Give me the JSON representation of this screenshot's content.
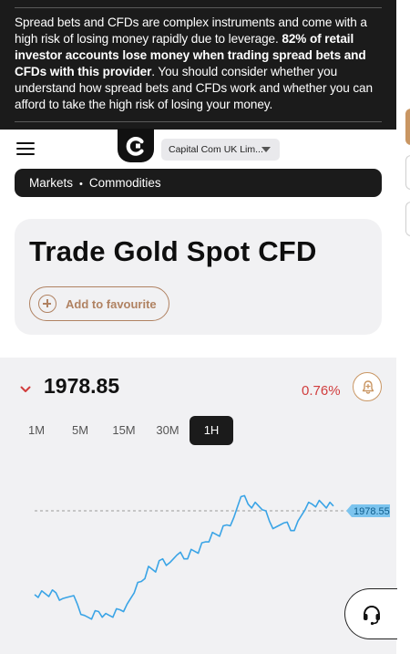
{
  "risk_warning": {
    "part1": "Spread bets and CFDs are complex instruments and come with a high risk of losing money rapidly due to leverage. ",
    "bold": "82% of retail investor accounts lose money when trading spread bets and CFDs with this provider",
    "part2": ". You should consider whether you understand how spread bets and CFDs work and whether you can afford to take the high risk of losing your money."
  },
  "header": {
    "entity_selector": "Capital Com UK Lim..."
  },
  "breadcrumb": {
    "items": [
      "Markets",
      "Commodities"
    ],
    "separator": "•"
  },
  "instrument": {
    "title": "Trade Gold Spot CFD",
    "favourite_label": "Add to favourite"
  },
  "quote": {
    "price": "1978.85",
    "change": "0.76%",
    "direction": "down",
    "last_label": "1978.55"
  },
  "timeframes": [
    "1M",
    "5M",
    "15M",
    "30M",
    "1H"
  ],
  "active_timeframe": "1H",
  "colors": {
    "brand_accent": "#c99663",
    "negative": "#d13d3d",
    "line": "#3aa4e6",
    "dark": "#1b1b1b"
  },
  "icons": {
    "menu": "hamburger-icon",
    "favourite": "plus-circle-icon",
    "alert": "bell-plus-icon",
    "direction": "chevron-down-icon",
    "support": "headset-icon"
  },
  "chart_data": {
    "type": "line",
    "series": [
      {
        "values": [
          1974.1,
          1974.3,
          1974.0,
          1974.2,
          1973.9,
          1974.0,
          1973.6,
          1973.0,
          1972.8,
          1973.2,
          1973.1,
          1972.9,
          1973.3,
          1973.6,
          1974.2,
          1974.8,
          1975.6,
          1975.3,
          1976.0,
          1975.8,
          1976.2,
          1976.0,
          1976.5,
          1976.3,
          1976.9,
          1977.4,
          1977.2,
          1977.8,
          1978.2,
          1979.3,
          1978.9,
          1979.0,
          1978.6,
          1978.0,
          1977.7,
          1977.9,
          1977.5,
          1978.0,
          1978.6,
          1978.9,
          1979.1,
          1978.7,
          1978.8
        ]
      }
    ],
    "last_value": 1978.55,
    "ylim": [
      1972.5,
      1980.0
    ],
    "grid": false,
    "reference_line": "dashed at last value"
  }
}
